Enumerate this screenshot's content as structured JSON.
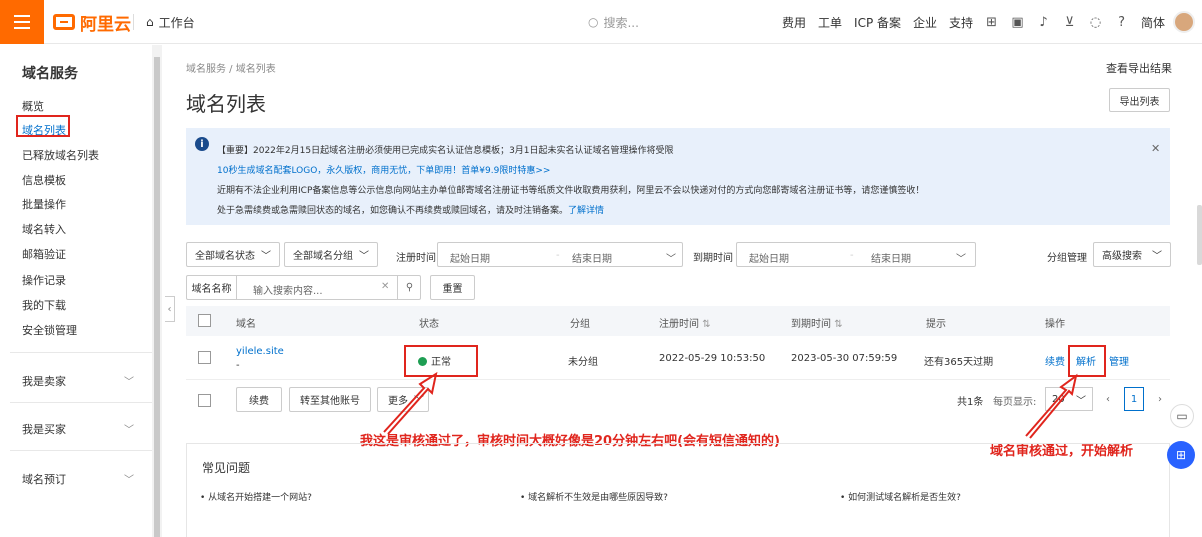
{
  "topbar": {
    "logo": "阿里云",
    "workbench": "工作台",
    "search_placeholder": "搜索...",
    "links": [
      "费用",
      "工单",
      "ICP 备案",
      "企业",
      "支持"
    ],
    "lang": "简体"
  },
  "sidebar": {
    "title": "域名服务",
    "items": [
      "概览",
      "域名列表",
      "已释放域名列表",
      "信息模板",
      "批量操作",
      "域名转入",
      "邮箱验证",
      "操作记录",
      "我的下载",
      "安全锁管理"
    ],
    "groups": [
      "我是卖家",
      "我是买家",
      "域名预订"
    ]
  },
  "main": {
    "breadcrumb": "域名服务  /  域名列表",
    "export_results": "查看导出结果",
    "title": "域名列表",
    "export_button": "导出列表"
  },
  "notice": {
    "line1": "【重要】2022年2月15日起域名注册必须使用已完成实名认证信息模板；3月1日起未实名认证域名管理操作将受限",
    "line2": "10秒生成域名配套LOGO，永久版权，商用无忧，下单即用！首单¥9.9限时特惠>>",
    "line3": "近期有不法企业利用ICP备案信息等公示信息向网站主办单位邮寄域名注册证书等纸质文件收取费用获利，阿里云不会以快递对付的方式向您邮寄域名注册证书等，请您谨慎签收！",
    "line4_text": "处于急需续费或急需赎回状态的域名，如您确认不再续费或赎回域名，请及时注销备案。",
    "line4_link": "了解详情"
  },
  "filters": {
    "status": "全部域名状态",
    "group": "全部域名分组",
    "reg_time_label": "注册时间",
    "exp_time_label": "到期时间",
    "start_date": "起始日期",
    "end_date": "结束日期",
    "group_manage": "分组管理",
    "advanced": "高级搜索",
    "search_key": "域名名称",
    "search_placeholder": "输入搜索内容...",
    "reset": "重置"
  },
  "table": {
    "headers": [
      "域名",
      "状态",
      "分组",
      "注册时间",
      "到期时间",
      "提示",
      "操作"
    ],
    "sort_mark": "⇅",
    "rows": [
      {
        "domain": "yilele.site",
        "dash": "-",
        "status": "正常",
        "group": "未分组",
        "reg_time": "2022-05-29 10:53:50",
        "exp_time": "2023-05-30 07:59:59",
        "tip": "还有365天过期",
        "actions": [
          "续费",
          "解析",
          "管理"
        ]
      }
    ]
  },
  "bulk": {
    "renew": "续费",
    "transfer": "转至其他账号",
    "more": "更多"
  },
  "pager": {
    "total": "共1条",
    "per_page_label": "每页显示:",
    "per_page": "20",
    "current": "1"
  },
  "annotations": {
    "left": "我这是审核通过了，审核时间大概好像是20分钟左右吧(会有短信通知的)",
    "right": "域名审核通过，开始解析"
  },
  "faq": {
    "title": "常见问题",
    "questions": [
      "• 从域名开始搭建一个网站?",
      "• 域名解析不生效是由哪些原因导致?",
      "• 如何测试域名解析是否生效?"
    ]
  },
  "colors": {
    "brand": "#ff6a00",
    "link": "#0070cc",
    "annotation": "#e0251d",
    "success": "#1e9e53"
  }
}
